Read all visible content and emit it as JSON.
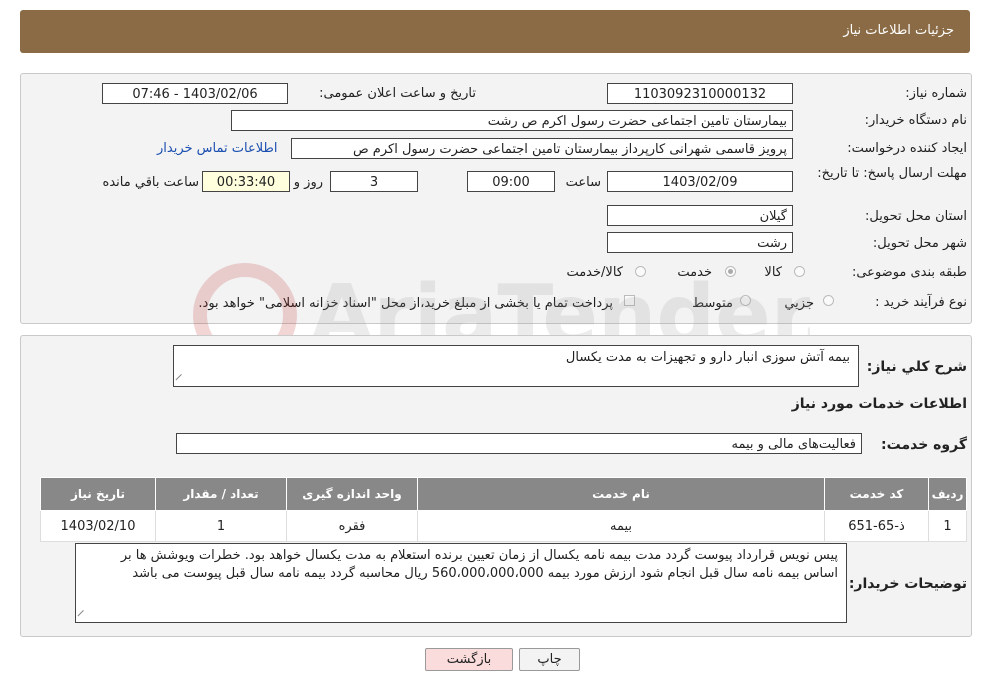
{
  "header": {
    "title": "جزئیات اطلاعات نیاز"
  },
  "labels": {
    "need_number": "شماره نیاز:",
    "announce_datetime": "تاریخ و ساعت اعلان عمومی:",
    "buyer_org": "نام دستگاه خریدار:",
    "requester": "ایجاد کننده درخواست:",
    "deadline": "مهلت ارسال پاسخ: تا تاریخ:",
    "hour": "ساعت",
    "day_and": "روز و",
    "remaining": "ساعت باقي مانده",
    "province": "استان محل تحویل:",
    "city": "شهر محل تحویل:",
    "category": "طبقه بندی موضوعی:",
    "purchase_type": "نوع فرآیند خرید :",
    "general_desc": "شرح کلي نياز:",
    "services_info": "اطلاعات خدمات مورد نیاز",
    "service_group": "گروه خدمت:",
    "buyer_notes": "توضیحات خریدار:"
  },
  "values": {
    "need_number": "1103092310000132",
    "announce_datetime": "1403/02/06 - 07:46",
    "buyer_org": "بیمارستان  تامین اجتماعی حضرت رسول اکرم ص رشت",
    "requester": "پرویز قاسمی شهرانی کارپرداز بیمارستان  تامین اجتماعی حضرت رسول اکرم ص",
    "contact_link": "اطلاعات تماس خریدار",
    "deadline_date": "1403/02/09",
    "deadline_time": "09:00",
    "days": "3",
    "remaining_time": "00:33:40",
    "province": "گیلان",
    "city": "رشت",
    "general_desc": "بیمه آتش سوزی انبار دارو و تجهیزات به مدت یکسال",
    "service_group": "فعالیت‌های مالی و بیمه",
    "buyer_notes": "پیس نویس قرارداد پیوست گردد مدت بیمه نامه یکسال از زمان تعیین برنده استعلام به مدت یکسال خواهد بود. خطرات ویوشش ها بر اساس بیمه نامه سال قبل انجام شود ارزش مورد بیمه 560،000،000،000 ریال محاسبه گردد بیمه نامه سال قبل پیوست می باشد"
  },
  "category_options": [
    {
      "label": "کالا",
      "selected": false
    },
    {
      "label": "خدمت",
      "selected": true
    },
    {
      "label": "کالا/خدمت",
      "selected": false
    }
  ],
  "purchase_options": [
    {
      "label": "جزیي",
      "selected": false
    },
    {
      "label": "متوسط",
      "selected": false
    }
  ],
  "payment_note": "پرداخت تمام یا بخشی از مبلغ خرید،از محل \"اسناد خزانه اسلامی\" خواهد بود.",
  "table": {
    "headers": [
      "ردیف",
      "کد خدمت",
      "نام خدمت",
      "واحد اندازه گیری",
      "تعداد / مقدار",
      "تاریخ نیاز"
    ],
    "rows": [
      [
        "1",
        "ذ-65-651",
        "بیمه",
        "فقره",
        "1",
        "1403/02/10"
      ]
    ]
  },
  "buttons": {
    "print": "چاپ",
    "back": "بازگشت"
  },
  "watermark": "AriaTender.neT"
}
